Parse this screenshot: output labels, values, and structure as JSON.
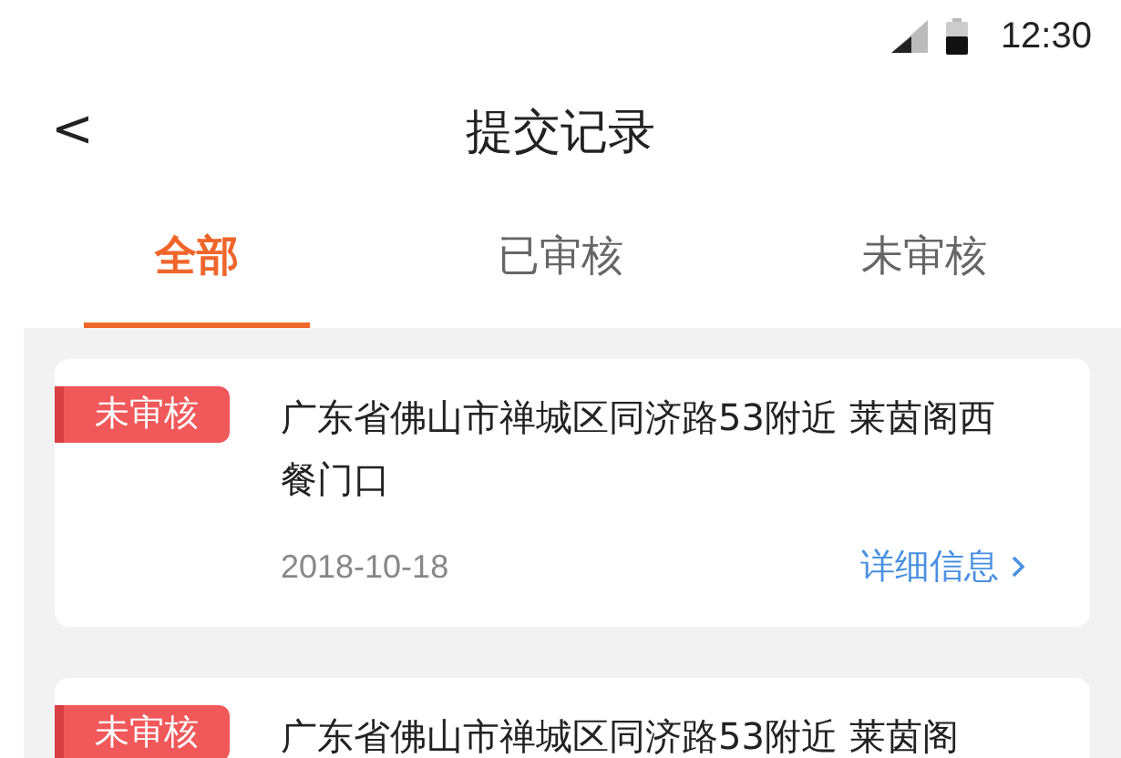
{
  "status_bar": {
    "time": "12:30"
  },
  "header": {
    "back": "<",
    "title": "提交记录"
  },
  "tabs": [
    {
      "label": "全部",
      "selected": true
    },
    {
      "label": "已审核",
      "selected": false
    },
    {
      "label": "未审核",
      "selected": false
    }
  ],
  "records": [
    {
      "status": "未审核",
      "title": "广东省佛山市禅城区同济路53附近 莱茵阁西餐门口",
      "date": "2018-10-18",
      "link": "详细信息"
    },
    {
      "status": "未审核",
      "title": "广东省佛山市禅城区同济路53附近 莱茵阁"
    }
  ]
}
